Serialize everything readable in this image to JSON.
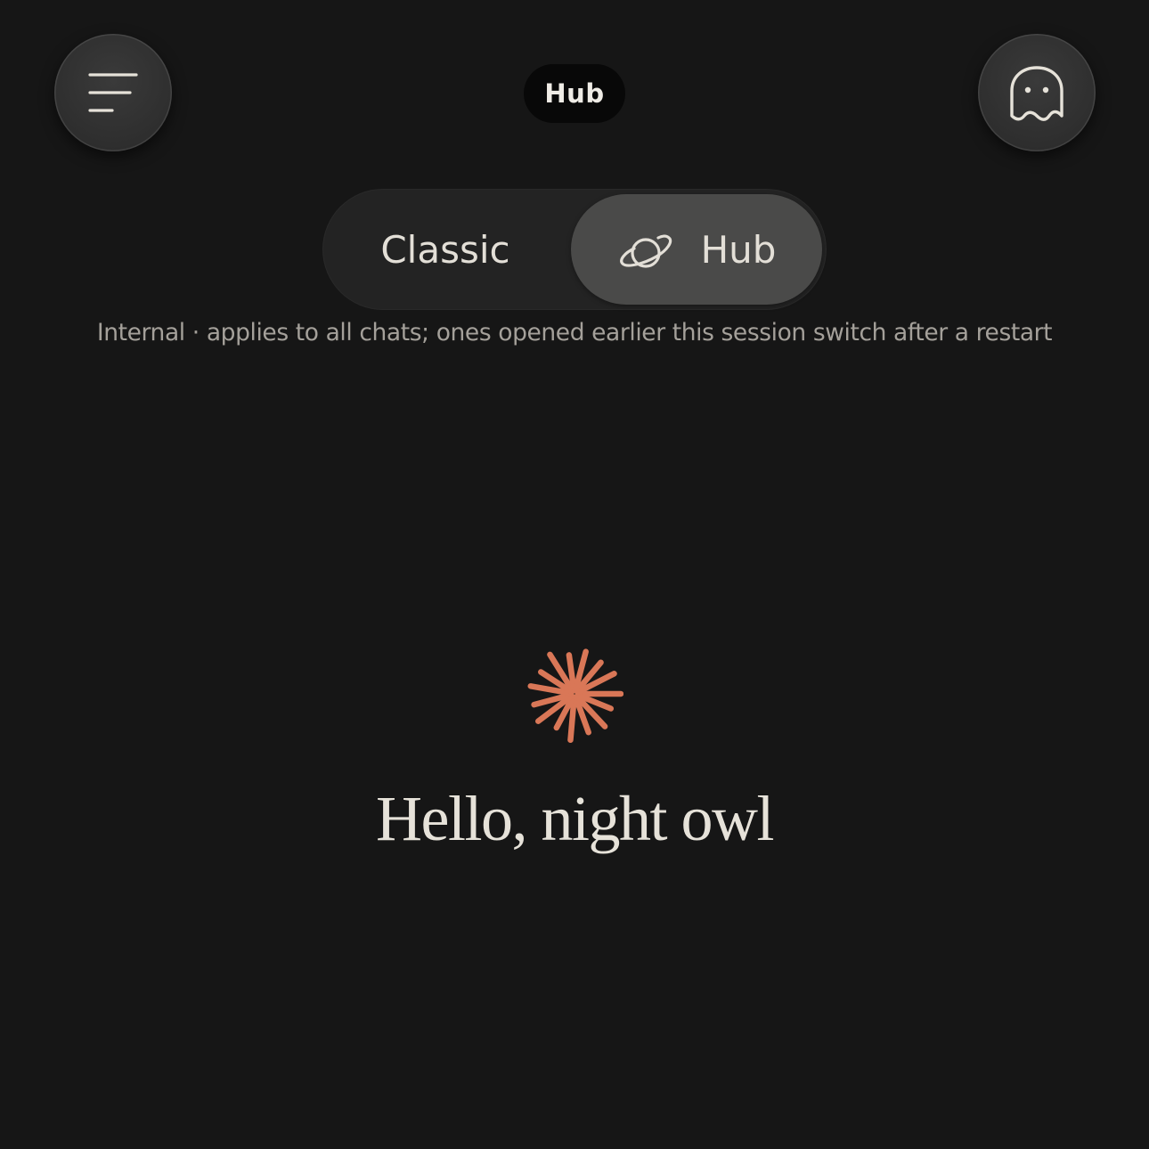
{
  "header": {
    "title": "Hub",
    "menu_icon": "menu-lines-icon",
    "ghost_icon": "ghost-icon"
  },
  "mode_toggle": {
    "options": [
      {
        "label": "Classic",
        "selected": false
      },
      {
        "label": "Hub",
        "selected": true,
        "icon": "planet-icon"
      }
    ]
  },
  "notice": "Internal · applies to all chats; ones opened earlier this session switch after a restart",
  "greeting": "Hello, night owl",
  "colors": {
    "background": "#161616",
    "accent": "#d97757",
    "text": "#e6e2d9",
    "muted_text": "#a4a09a"
  }
}
